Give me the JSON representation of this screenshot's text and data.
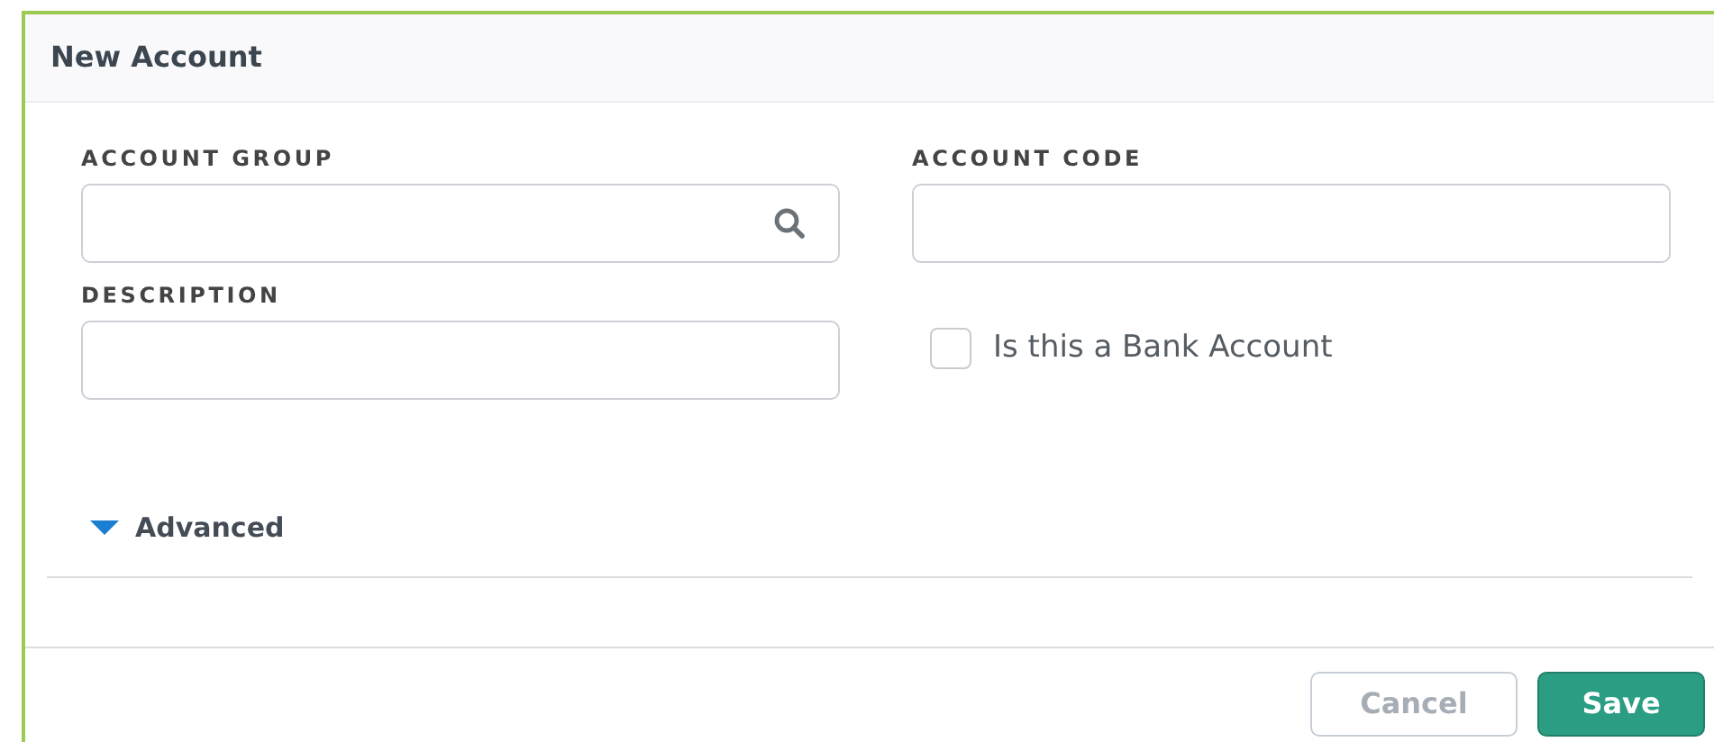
{
  "dialog": {
    "title": "New Account"
  },
  "fields": [
    {
      "label": "ACCOUNT GROUP",
      "kind": "search"
    },
    {
      "label": "ACCOUNT CODE",
      "kind": "text"
    },
    {
      "label": "DESCRIPTION",
      "kind": "text"
    }
  ],
  "bank_account": {
    "label": "Is this a Bank Account",
    "checked": false
  },
  "advanced": {
    "label": "Advanced",
    "expanded": true
  },
  "buttons": [
    {
      "label": "Cancel",
      "kind": "secondary"
    },
    {
      "label": "Save",
      "kind": "primary"
    }
  ]
}
